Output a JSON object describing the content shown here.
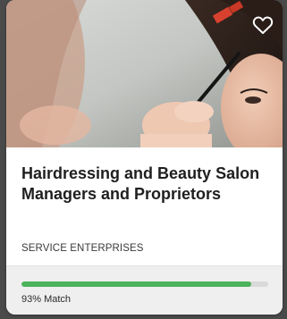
{
  "card": {
    "title": "Hairdressing and Beauty Salon Managers and Proprietors",
    "category": "SERVICE ENTERPRISES",
    "match_fraction": 0.93,
    "match_label": "93% Match",
    "image_icon": "salon-photo",
    "favorite_icon": "heart-outline-icon"
  },
  "colors": {
    "progress_fill": "#4bb35b",
    "progress_track": "#d9d9d9",
    "card_bg": "#ffffff",
    "footer_bg": "#efefef",
    "page_bg": "#4a4a4a"
  }
}
